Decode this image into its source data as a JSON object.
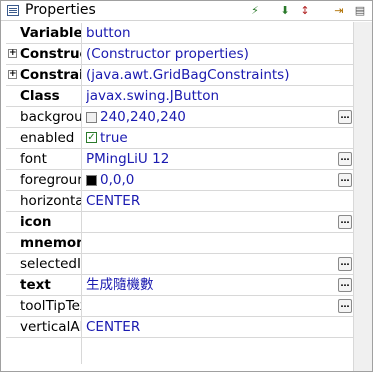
{
  "panel": {
    "title": "Properties"
  },
  "toolbar": {
    "icons": [
      "show-events-icon",
      "show-advanced-icon",
      "sort-icon",
      "goto-definition-icon",
      "menu-icon"
    ]
  },
  "rows": [
    {
      "name": "Variable",
      "value": "button",
      "bold": true,
      "color": "#1a1ab0"
    },
    {
      "name": "Constructor",
      "value": "(Constructor properties)",
      "bold": true,
      "expandable": true
    },
    {
      "name": "Constraints",
      "value": "(java.awt.GridBagConstraints)",
      "bold": true,
      "expandable": true
    },
    {
      "name": "Class",
      "value": "javax.swing.JButton",
      "bold": true
    },
    {
      "name": "background",
      "value": "240,240,240",
      "swatch": "#f0f0f0",
      "dots": true
    },
    {
      "name": "enabled",
      "value": "true",
      "checkbox": true
    },
    {
      "name": "font",
      "value": "PMingLiU 12",
      "dots": true
    },
    {
      "name": "foreground",
      "value": "0,0,0",
      "swatch": "#000000",
      "dots": true
    },
    {
      "name": "horizontalAlignment",
      "value": "CENTER"
    },
    {
      "name": "icon",
      "value": "",
      "bold": true,
      "dots": true
    },
    {
      "name": "mnemonic",
      "value": "",
      "bold": true
    },
    {
      "name": "selectedIcon",
      "value": "",
      "dots": true
    },
    {
      "name": "text",
      "value": "生成隨機數",
      "bold": true,
      "dots": true
    },
    {
      "name": "toolTipText",
      "value": "",
      "dots": true
    },
    {
      "name": "verticalAlignment",
      "value": "CENTER"
    }
  ]
}
